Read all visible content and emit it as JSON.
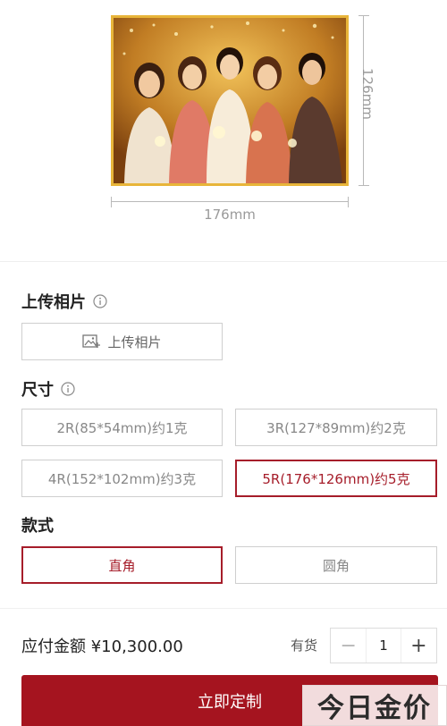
{
  "preview": {
    "height_label": "126mm",
    "width_label": "176mm"
  },
  "upload": {
    "section_title": "上传相片",
    "button_label": "上传相片"
  },
  "size": {
    "section_title": "尺寸",
    "options": [
      {
        "label": "2R(85*54mm)约1克",
        "selected": false
      },
      {
        "label": "3R(127*89mm)约2克",
        "selected": false
      },
      {
        "label": "4R(152*102mm)约3克",
        "selected": false
      },
      {
        "label": "5R(176*126mm)约5克",
        "selected": true
      }
    ]
  },
  "style": {
    "section_title": "款式",
    "options": [
      {
        "label": "直角",
        "selected": true
      },
      {
        "label": "圆角",
        "selected": false
      }
    ]
  },
  "order": {
    "total_label": "应付金额 ¥10,300.00",
    "stock_label": "有货",
    "quantity": "1",
    "minus_symbol": "−",
    "plus_symbol": "+",
    "buy_button": "立即定制"
  },
  "watermark": "今日金价",
  "colors": {
    "accent": "#a5141f",
    "frame": "#e8b53a"
  }
}
